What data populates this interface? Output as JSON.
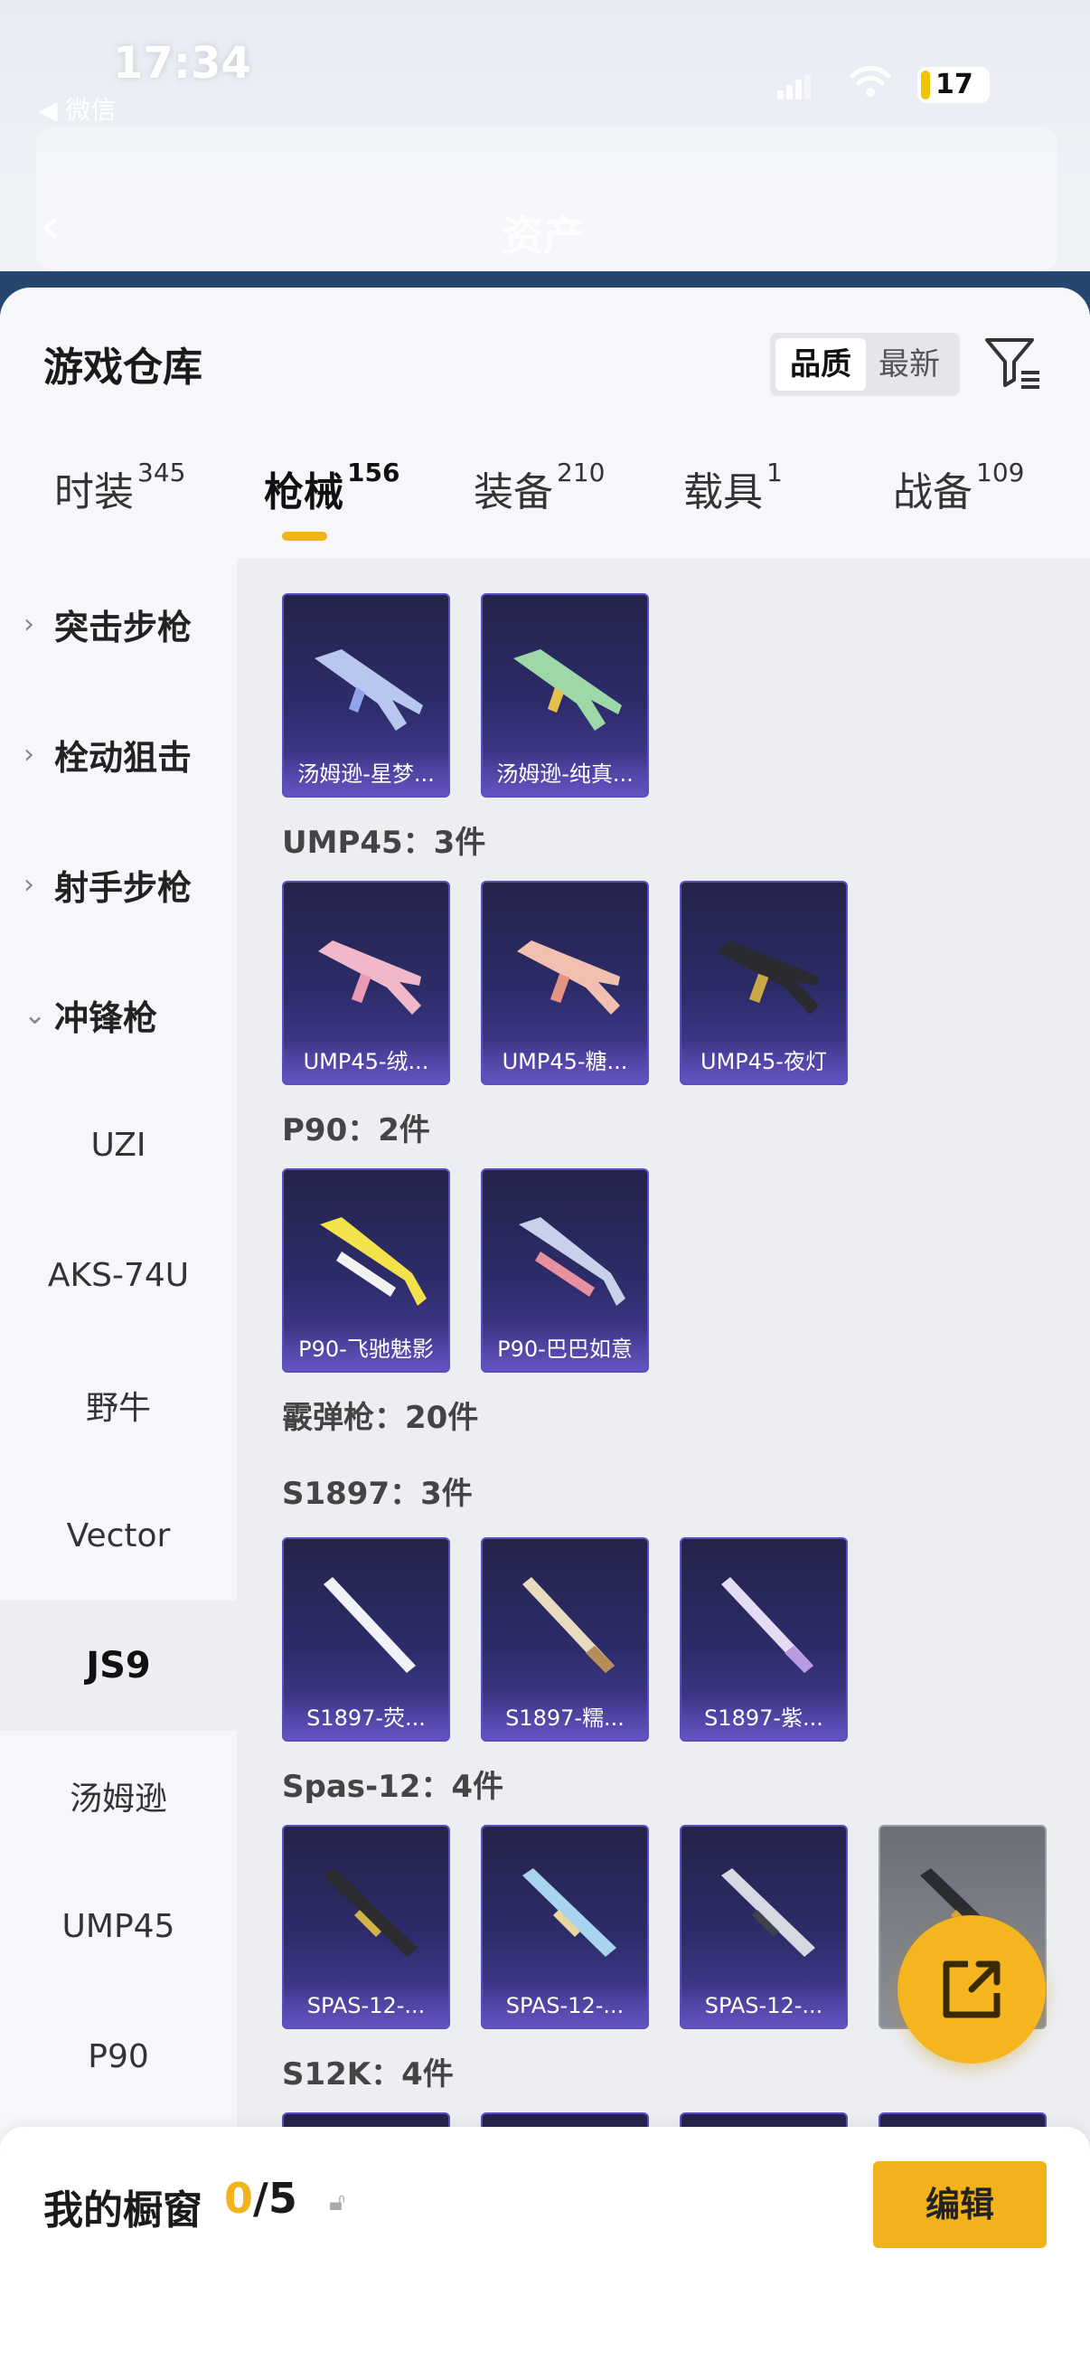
{
  "status": {
    "time": "17:34",
    "back_app": "◀ 微信",
    "battery": "17"
  },
  "bg_header": {
    "title": "资产"
  },
  "header": {
    "title": "游戏仓库",
    "sort_active": "品质",
    "sort_inactive": "最新"
  },
  "tabs": [
    {
      "label": "时装",
      "count": "345"
    },
    {
      "label": "枪械",
      "count": "156"
    },
    {
      "label": "装备",
      "count": "210"
    },
    {
      "label": "载具",
      "count": "1"
    },
    {
      "label": "战备",
      "count": "109"
    }
  ],
  "sidebar": [
    {
      "label": "突击步枪",
      "type": "parent",
      "chev": "›"
    },
    {
      "label": "栓动狙击",
      "type": "parent",
      "chev": "›"
    },
    {
      "label": "射手步枪",
      "type": "parent",
      "chev": "›"
    },
    {
      "label": "冲锋枪",
      "type": "parent",
      "chev": "⌄"
    },
    {
      "label": "UZI"
    },
    {
      "label": "AKS-74U"
    },
    {
      "label": "野牛"
    },
    {
      "label": "Vector"
    },
    {
      "label": "JS9",
      "selected": true
    },
    {
      "label": "汤姆逊"
    },
    {
      "label": "UMP45"
    },
    {
      "label": "P90"
    }
  ],
  "sections": [
    {
      "title": "UMP45：3件"
    },
    {
      "title": "P90：2件"
    },
    {
      "title": "霰弹枪：20件"
    },
    {
      "title": "S1897：3件"
    },
    {
      "title": "Spas-12：4件"
    },
    {
      "title": "S12K：4件"
    }
  ],
  "cards": {
    "tommy": [
      "汤姆逊-星梦...",
      "汤姆逊-纯真..."
    ],
    "ump": [
      "UMP45-绒...",
      "UMP45-糖...",
      "UMP45-夜灯"
    ],
    "p90": [
      "P90-飞驰魅影",
      "P90-巴巴如意"
    ],
    "s1897": [
      "S1897-荧...",
      "S1897-糯...",
      "S1897-紫..."
    ],
    "spas": [
      "SPAS-12-...",
      "SPAS-12-...",
      "SPAS-12-..."
    ]
  },
  "bottom": {
    "label": "我的橱窗",
    "used": "0",
    "total": "/5",
    "edit": "编辑"
  },
  "colors": {
    "accent": "#f2b21b",
    "card_bg": "#2d2c6a"
  }
}
